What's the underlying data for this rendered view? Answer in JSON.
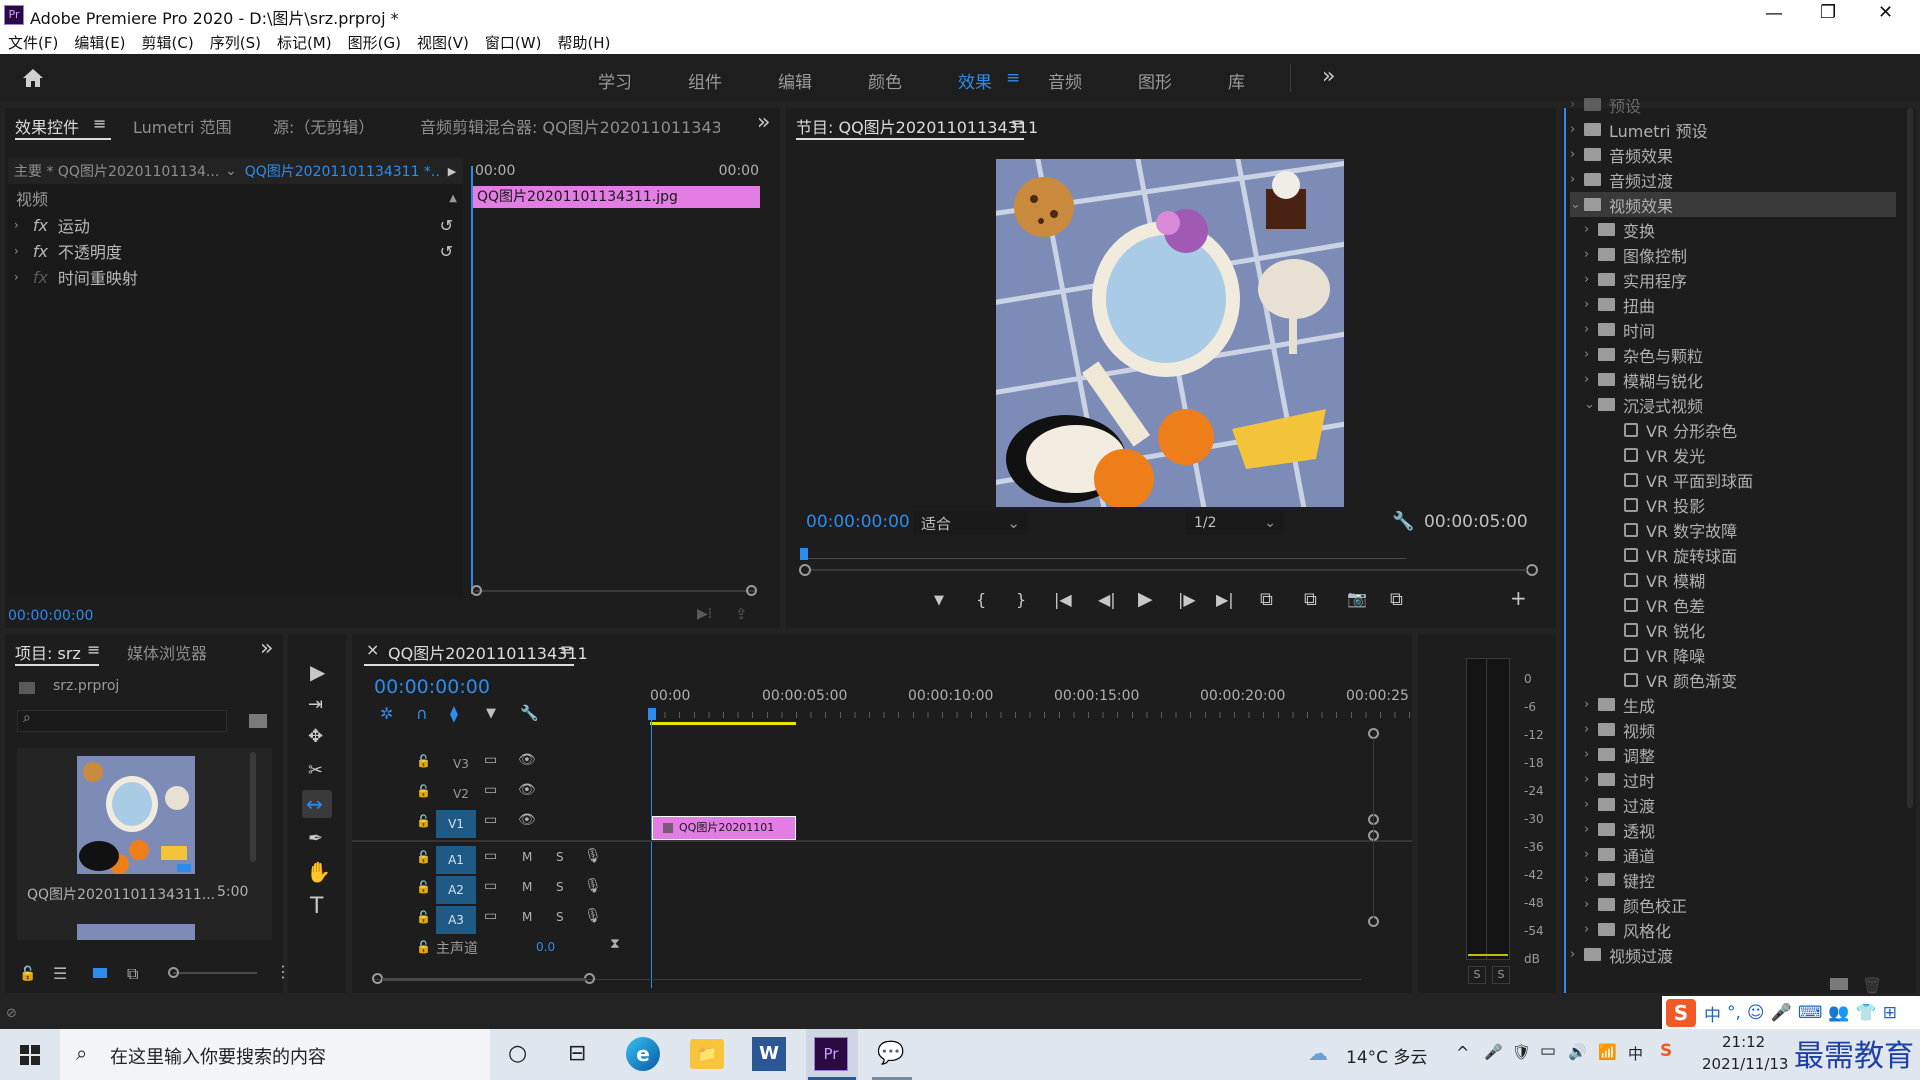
{
  "window": {
    "title": "Adobe Premiere Pro 2020 - D:\\图片\\srz.prproj *",
    "logo": "Pr",
    "controls": [
      "—",
      "❐",
      "✕"
    ]
  },
  "menu": [
    "文件(F)",
    "编辑(E)",
    "剪辑(C)",
    "序列(S)",
    "标记(M)",
    "图形(G)",
    "视图(V)",
    "窗口(W)",
    "帮助(H)"
  ],
  "workspaces": {
    "items": [
      "学习",
      "组件",
      "编辑",
      "颜色",
      "效果",
      "音频",
      "图形",
      "库"
    ],
    "active": "效果",
    "menu_glyph": "≡",
    "more_glyph": "»"
  },
  "effect_controls": {
    "tabs": [
      "效果控件",
      "Lumetri 范围",
      "源:（无剪辑）",
      "音频剪辑混合器: QQ图片20201101134311"
    ],
    "tab_menu": "≡",
    "more": "»",
    "master_label": "主要 * QQ图片20201101134...",
    "sequence_label": "QQ图片20201101134311 *...",
    "play_glyph": "▶",
    "time_start": "00:00",
    "time_end": "00:00",
    "section": "视频",
    "fx": [
      "fx",
      "fx",
      "fx"
    ],
    "rows": [
      "运动",
      "不透明度",
      "时间重映射"
    ],
    "reset_glyph": "↺",
    "clip_name": "QQ图片20201101134311.jpg",
    "timecode": "00:00:00:00"
  },
  "program_monitor": {
    "title": "节目: QQ图片20201101134311",
    "title_menu": "≡",
    "timecode": "00:00:00:00",
    "fit": "适合",
    "resolution": "1/2",
    "duration": "00:00:05:00",
    "controls": [
      "▼",
      "{",
      "}",
      "|◀",
      "◀|",
      "▶",
      "|▶",
      "▶|",
      "⧉",
      "⧉",
      "📷",
      "⧉",
      "+"
    ]
  },
  "effects_panel": {
    "top_items": [
      {
        "label": "预设",
        "open": false
      },
      {
        "label": "Lumetri 预设",
        "open": false
      },
      {
        "label": "音频效果",
        "open": false
      },
      {
        "label": "音频过渡",
        "open": false
      },
      {
        "label": "视频效果",
        "open": true,
        "selected": true
      }
    ],
    "video_effect_folders": [
      "变换",
      "图像控制",
      "实用程序",
      "扭曲",
      "时间",
      "杂色与颗粒",
      "模糊与锐化",
      "沉浸式视频"
    ],
    "immersive_items": [
      "VR 分形杂色",
      "VR 发光",
      "VR 平面到球面",
      "VR 投影",
      "VR 数字故障",
      "VR 旋转球面",
      "VR 模糊",
      "VR 色差",
      "VR 锐化",
      "VR 降噪",
      "VR 颜色渐变"
    ],
    "more_folders": [
      "生成",
      "视频",
      "调整",
      "过时",
      "过渡",
      "透视",
      "通道",
      "键控",
      "颜色校正",
      "风格化"
    ],
    "last_item": "视频过渡"
  },
  "project_panel": {
    "tabs": [
      "项目: srz",
      "媒体浏览器"
    ],
    "tab_menu": "≡",
    "more": "»",
    "file": "srz.prproj",
    "search_placeholder": "",
    "clip_name": "QQ图片20201101134311...",
    "clip_duration": "5:00"
  },
  "tools": [
    "▶",
    "⇥",
    "✥",
    "✂",
    "↔",
    "✒",
    "✋",
    "T"
  ],
  "timeline": {
    "close": "×",
    "title": "QQ图片20201101134311",
    "title_menu": "≡",
    "timecode": "00:00:00:00",
    "ruler": [
      "00:00",
      "00:00:05:00",
      "00:00:10:00",
      "00:00:15:00",
      "00:00:20:00",
      "00:00:25:00"
    ],
    "video_tracks": [
      "V3",
      "V2",
      "V1"
    ],
    "audio_tracks": [
      "A1",
      "A2",
      "A3"
    ],
    "m": "M",
    "s": "S",
    "master": "主声道",
    "master_value": "0.0",
    "clip": "QQ图片20201101",
    "tool_icons": [
      "✲",
      "∩",
      "⧫",
      "▼",
      "🔧"
    ]
  },
  "audio_meter": {
    "scale": [
      "0",
      "-6",
      "-12",
      "-18",
      "-24",
      "-30",
      "-36",
      "-42",
      "-48",
      "-54",
      "dB"
    ],
    "solo": [
      "S",
      "S"
    ]
  },
  "ime_bar": {
    "items": [
      "S",
      "中",
      "°,",
      "☺",
      "🎤",
      "⌨",
      "👥",
      "👕",
      "⊞"
    ]
  },
  "taskbar": {
    "search_placeholder": "在这里输入你要搜索的内容",
    "weather": "14°C 多云",
    "time": "21:12",
    "date": "2021/11/13",
    "watermark": "最需教育",
    "apps": [
      "○",
      "⊟",
      "e",
      "📁",
      "W",
      "Pr",
      "💬"
    ],
    "tray": [
      "^",
      "🎤",
      "🛡",
      "▭",
      "🔊",
      "📶",
      "中",
      "S"
    ]
  },
  "colors": {
    "accent": "#2d8ceb",
    "clip_pink": "#e27de3",
    "track_blue": "#1f5a86",
    "playhead_yellow": "#e6e600"
  }
}
